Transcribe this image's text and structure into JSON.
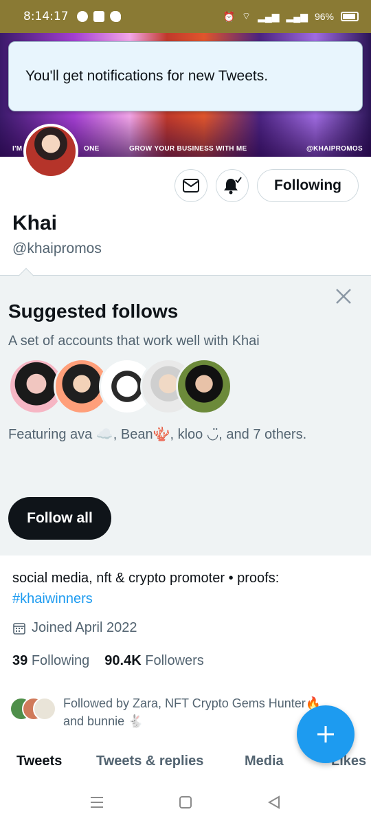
{
  "status": {
    "time": "8:14:17",
    "battery": "96%"
  },
  "banner": {
    "tag_left": "I'M F",
    "tag_left2": "ONE",
    "tag_center": "GROW YOUR BUSINESS WITH ME",
    "tag_right": "@KHAIPROMOS"
  },
  "toast": {
    "text": "You'll get notifications for new Tweets."
  },
  "profile": {
    "name": "Khai",
    "handle": "@khaipromos",
    "following_button": "Following",
    "bio_text": "social media, nft & crypto promoter • proofs: ",
    "bio_hashtag": "#khaiwinners",
    "joined": "Joined April 2022",
    "following_count": "39",
    "following_label": "Following",
    "followers_count": "90.4K",
    "followers_label": "Followers",
    "followed_by": "Followed by Zara, NFT Crypto Gems Hunter🔥 and bunnie 🐇"
  },
  "suggested": {
    "title": "Suggested follows",
    "subtitle": "A set of accounts that work well with Khai",
    "featuring": "Featuring ava ☁️, Bean🪸, kloo ◡̈, and 7 others.",
    "follow_all": "Follow all"
  },
  "tabs": [
    "Tweets",
    "Tweets & replies",
    "Media",
    "Likes"
  ],
  "colors": {
    "accent": "#1d9bf0",
    "statusbar": "#8a7a34",
    "panel": "#eff3f4"
  },
  "icons": [
    "messenger-icon",
    "tiktok-icon",
    "twitter-icon",
    "alarm-icon",
    "wifi-icon",
    "signal-icon",
    "battery-icon",
    "mail-icon",
    "bell-check-icon",
    "close-icon",
    "calendar-icon",
    "plus-icon",
    "menu-icon",
    "home-square-icon",
    "back-triangle-icon"
  ]
}
